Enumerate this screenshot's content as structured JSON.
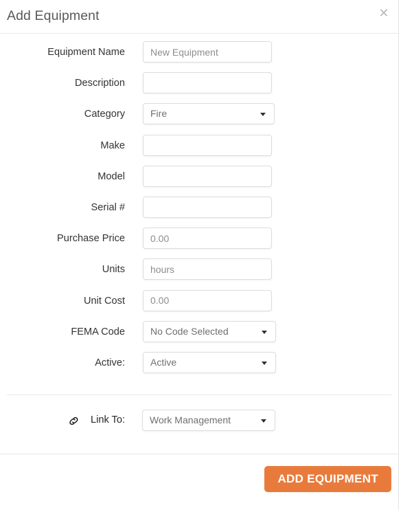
{
  "dialog": {
    "title": "Add Equipment",
    "close_icon": "close-icon"
  },
  "form": {
    "fields": [
      {
        "label": "Equipment Name",
        "type": "text",
        "value": "",
        "placeholder": "New Equipment"
      },
      {
        "label": "Description",
        "type": "text",
        "value": "",
        "placeholder": ""
      },
      {
        "label": "Category",
        "type": "select",
        "value": "Fire"
      },
      {
        "label": "Make",
        "type": "text",
        "value": "",
        "placeholder": ""
      },
      {
        "label": "Model",
        "type": "text",
        "value": "",
        "placeholder": ""
      },
      {
        "label": "Serial #",
        "type": "text",
        "value": "",
        "placeholder": ""
      },
      {
        "label": "Purchase Price",
        "type": "text",
        "value": "",
        "placeholder": "0.00"
      },
      {
        "label": "Units",
        "type": "text",
        "value": "",
        "placeholder": "hours"
      },
      {
        "label": "Unit Cost",
        "type": "text",
        "value": "",
        "placeholder": "0.00"
      },
      {
        "label": "FEMA Code",
        "type": "select",
        "value": "No Code Selected"
      },
      {
        "label": "Active:",
        "type": "select",
        "value": "Active"
      }
    ]
  },
  "link_section": {
    "icon": "chain-link-icon",
    "label": "Link To:",
    "value": "Work Management"
  },
  "footer": {
    "submit_label": "ADD EQUIPMENT"
  },
  "colors": {
    "accent": "#e87b3c",
    "border": "#dcdcdc",
    "divider": "#e7e7e7",
    "label_text": "#333333",
    "placeholder_text": "#8d8d8d"
  }
}
